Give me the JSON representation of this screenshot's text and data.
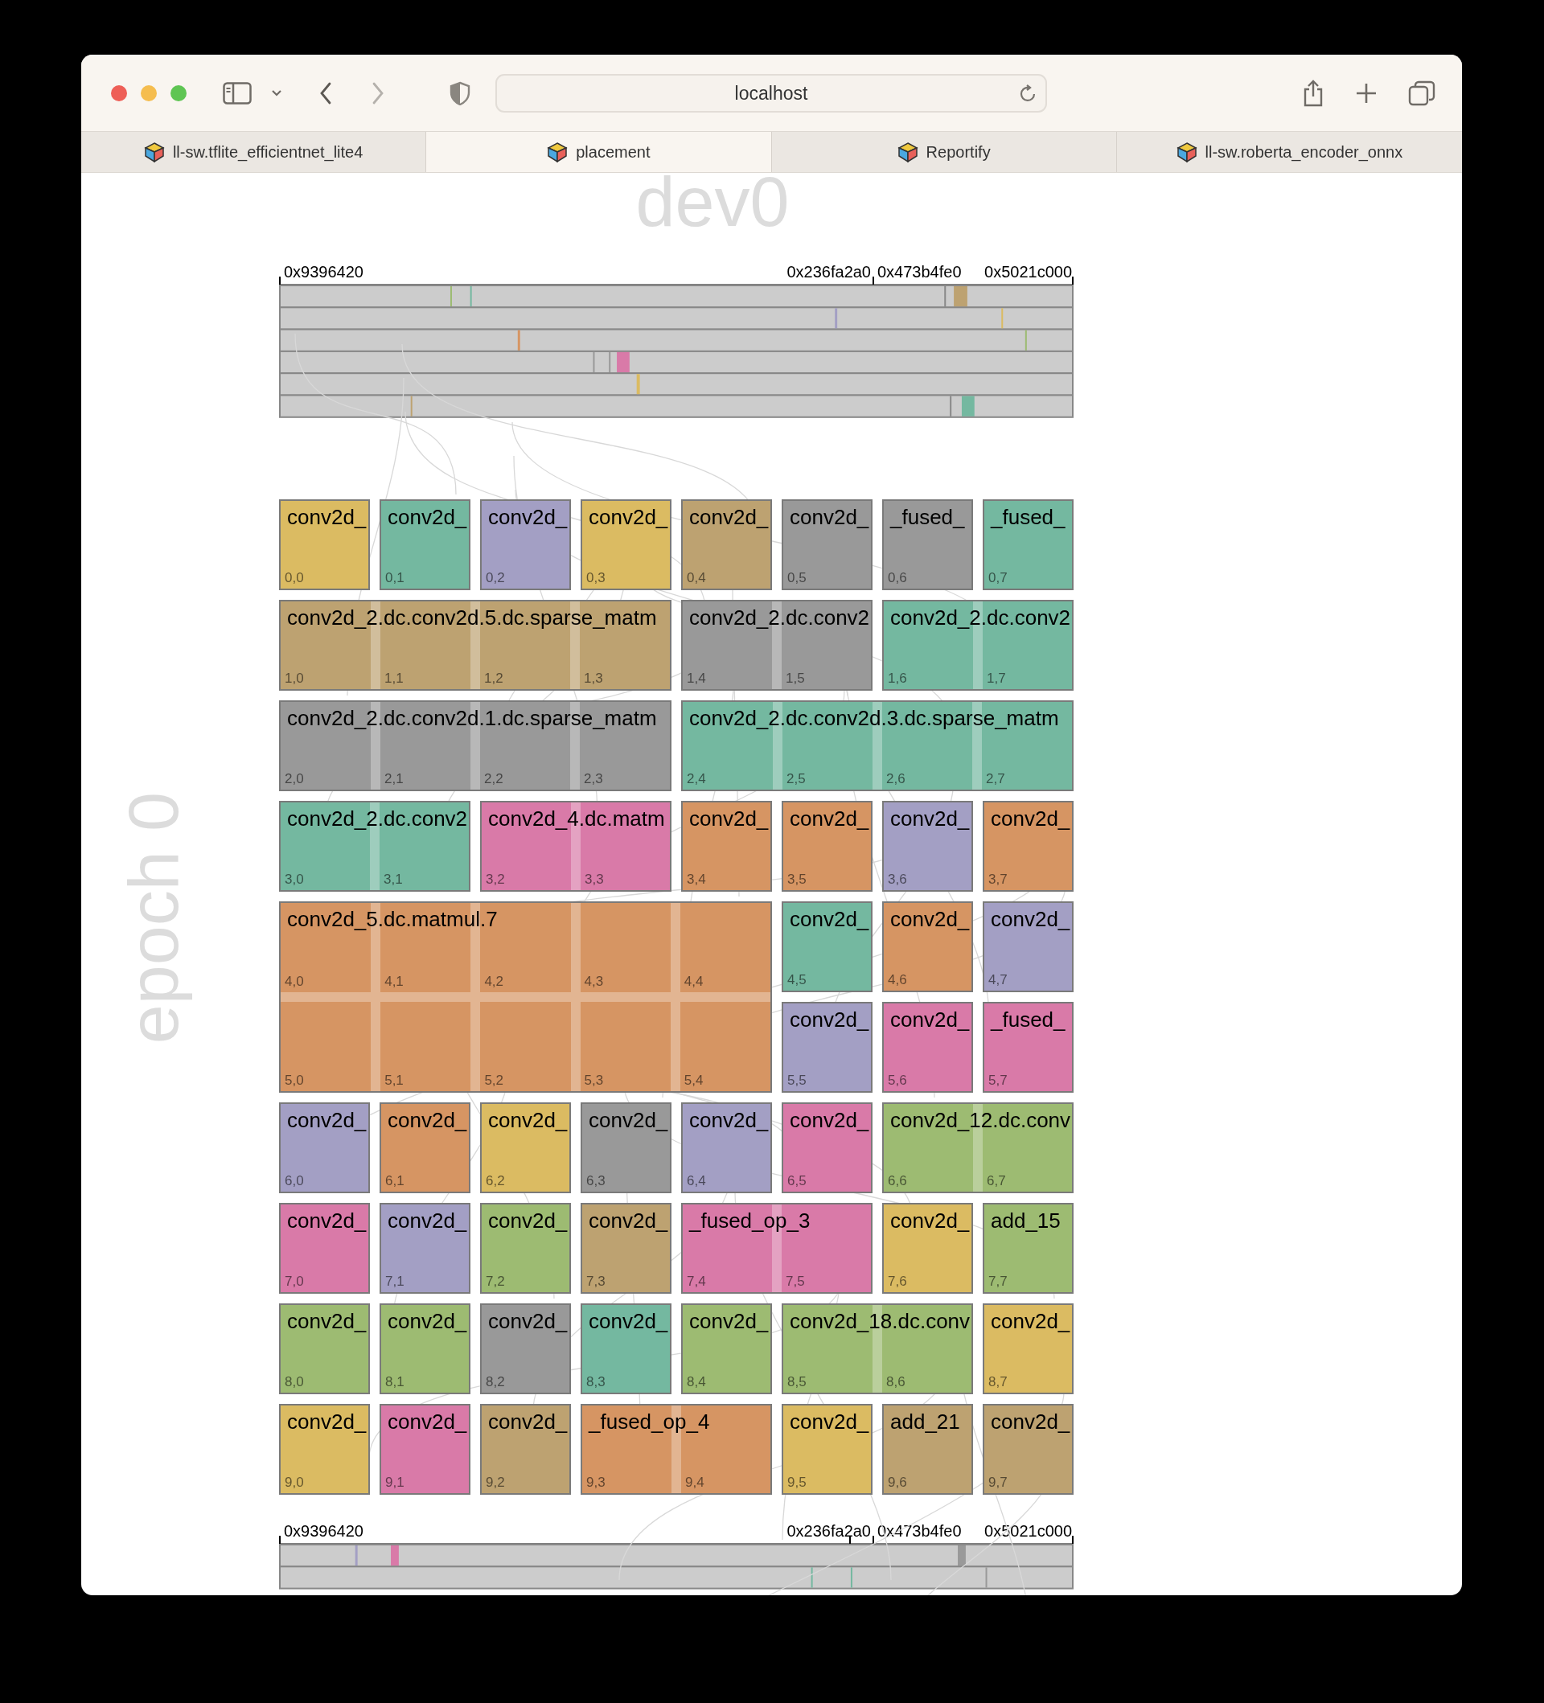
{
  "browser": {
    "address": "localhost",
    "tabs": [
      {
        "title": "ll-sw.tflite_efficientnet_lite4",
        "selected": false
      },
      {
        "title": "placement",
        "selected": true
      },
      {
        "title": "Reportify",
        "selected": false
      },
      {
        "title": "ll-sw.roberta_encoder_onnx",
        "selected": false
      }
    ]
  },
  "device": "dev0",
  "epoch": "epoch 0",
  "top_axis": {
    "labels": [
      "0x9396420",
      "0x236fa2a0",
      "0x473b4fe0",
      "0x5021c000"
    ]
  },
  "bottom_axis": {
    "labels": [
      "0x9396420",
      "0x236fa2a0",
      "0x473b4fe0",
      "0x5021c000"
    ]
  },
  "blocks": [
    {
      "label": "conv2d_",
      "color": "#dbbb62",
      "cells": [
        [
          "0,0"
        ]
      ]
    },
    {
      "label": "conv2d_",
      "color": "#74b8a0",
      "cells": [
        [
          "0,1"
        ]
      ]
    },
    {
      "label": "conv2d_",
      "color": "#a39fc4",
      "cells": [
        [
          "0,2"
        ]
      ]
    },
    {
      "label": "conv2d_",
      "color": "#dbbb62",
      "cells": [
        [
          "0,3"
        ]
      ]
    },
    {
      "label": "conv2d_",
      "color": "#bda271",
      "cells": [
        [
          "0,4"
        ]
      ]
    },
    {
      "label": "conv2d_",
      "color": "#999999",
      "cells": [
        [
          "0,5"
        ]
      ]
    },
    {
      "label": "_fused_",
      "color": "#999999",
      "cells": [
        [
          "0,6"
        ]
      ]
    },
    {
      "label": "_fused_",
      "color": "#74b8a0",
      "cells": [
        [
          "0,7"
        ]
      ]
    },
    {
      "label": "conv2d_2.dc.conv2d.5.dc.sparse_matm",
      "color": "#bda271",
      "cells": [
        [
          "1,0",
          "1,1",
          "1,2",
          "1,3"
        ]
      ]
    },
    {
      "label": "conv2d_2.dc.conv2",
      "color": "#999999",
      "cells": [
        [
          "1,4",
          "1,5"
        ]
      ]
    },
    {
      "label": "conv2d_2.dc.conv2",
      "color": "#74b8a0",
      "cells": [
        [
          "1,6",
          "1,7"
        ]
      ]
    },
    {
      "label": "conv2d_2.dc.conv2d.1.dc.sparse_matm",
      "color": "#999999",
      "cells": [
        [
          "2,0",
          "2,1",
          "2,2",
          "2,3"
        ]
      ]
    },
    {
      "label": "conv2d_2.dc.conv2d.3.dc.sparse_matm",
      "color": "#74b8a0",
      "cells": [
        [
          "2,4",
          "2,5",
          "2,6",
          "2,7"
        ]
      ]
    },
    {
      "label": "conv2d_2.dc.conv2",
      "color": "#74b8a0",
      "cells": [
        [
          "3,0",
          "3,1"
        ]
      ]
    },
    {
      "label": "conv2d_4.dc.matm",
      "color": "#d97aa8",
      "cells": [
        [
          "3,2",
          "3,3"
        ]
      ]
    },
    {
      "label": "conv2d_",
      "color": "#d69563",
      "cells": [
        [
          "3,4"
        ]
      ]
    },
    {
      "label": "conv2d_",
      "color": "#d69563",
      "cells": [
        [
          "3,5"
        ]
      ]
    },
    {
      "label": "conv2d_",
      "color": "#a39fc4",
      "cells": [
        [
          "3,6"
        ]
      ]
    },
    {
      "label": "conv2d_",
      "color": "#d69563",
      "cells": [
        [
          "3,7"
        ]
      ]
    },
    {
      "label": "conv2d_5.dc.matmul.7",
      "color": "#d69563",
      "cells": [
        [
          "4,0",
          "4,1",
          "4,2",
          "4,3",
          "4,4"
        ],
        [
          "5,0",
          "5,1",
          "5,2",
          "5,3",
          "5,4"
        ]
      ]
    },
    {
      "label": "conv2d_",
      "color": "#74b8a0",
      "cells": [
        [
          "4,5"
        ]
      ]
    },
    {
      "label": "conv2d_",
      "color": "#d69563",
      "cells": [
        [
          "4,6"
        ]
      ]
    },
    {
      "label": "conv2d_",
      "color": "#a39fc4",
      "cells": [
        [
          "4,7"
        ]
      ]
    },
    {
      "label": "conv2d_",
      "color": "#a39fc4",
      "cells": [
        [
          "5,5"
        ]
      ]
    },
    {
      "label": "conv2d_",
      "color": "#d97aa8",
      "cells": [
        [
          "5,6"
        ]
      ]
    },
    {
      "label": "_fused_",
      "color": "#d97aa8",
      "cells": [
        [
          "5,7"
        ]
      ]
    },
    {
      "label": "conv2d_",
      "color": "#a39fc4",
      "cells": [
        [
          "6,0"
        ]
      ]
    },
    {
      "label": "conv2d_",
      "color": "#d69563",
      "cells": [
        [
          "6,1"
        ]
      ]
    },
    {
      "label": "conv2d_",
      "color": "#dbbb62",
      "cells": [
        [
          "6,2"
        ]
      ]
    },
    {
      "label": "conv2d_",
      "color": "#999999",
      "cells": [
        [
          "6,3"
        ]
      ]
    },
    {
      "label": "conv2d_",
      "color": "#a39fc4",
      "cells": [
        [
          "6,4"
        ]
      ]
    },
    {
      "label": "conv2d_",
      "color": "#d97aa8",
      "cells": [
        [
          "6,5"
        ]
      ]
    },
    {
      "label": "conv2d_12.dc.conv",
      "color": "#9dbb72",
      "cells": [
        [
          "6,6",
          "6,7"
        ]
      ]
    },
    {
      "label": "conv2d_",
      "color": "#d97aa8",
      "cells": [
        [
          "7,0"
        ]
      ]
    },
    {
      "label": "conv2d_",
      "color": "#a39fc4",
      "cells": [
        [
          "7,1"
        ]
      ]
    },
    {
      "label": "conv2d_",
      "color": "#9dbb72",
      "cells": [
        [
          "7,2"
        ]
      ]
    },
    {
      "label": "conv2d_",
      "color": "#bda271",
      "cells": [
        [
          "7,3"
        ]
      ]
    },
    {
      "label": "_fused_op_3",
      "color": "#d97aa8",
      "cells": [
        [
          "7,4",
          "7,5"
        ]
      ]
    },
    {
      "label": "conv2d_",
      "color": "#dbbb62",
      "cells": [
        [
          "7,6"
        ]
      ]
    },
    {
      "label": "add_15",
      "color": "#9dbb72",
      "cells": [
        [
          "7,7"
        ]
      ]
    },
    {
      "label": "conv2d_",
      "color": "#9dbb72",
      "cells": [
        [
          "8,0"
        ]
      ]
    },
    {
      "label": "conv2d_",
      "color": "#9dbb72",
      "cells": [
        [
          "8,1"
        ]
      ]
    },
    {
      "label": "conv2d_",
      "color": "#999999",
      "cells": [
        [
          "8,2"
        ]
      ]
    },
    {
      "label": "conv2d_",
      "color": "#74b8a0",
      "cells": [
        [
          "8,3"
        ]
      ]
    },
    {
      "label": "conv2d_",
      "color": "#9dbb72",
      "cells": [
        [
          "8,4"
        ]
      ]
    },
    {
      "label": "conv2d_18.dc.conv",
      "color": "#9dbb72",
      "cells": [
        [
          "8,5",
          "8,6"
        ]
      ]
    },
    {
      "label": "conv2d_",
      "color": "#dbbb62",
      "cells": [
        [
          "8,7"
        ]
      ]
    },
    {
      "label": "conv2d_",
      "color": "#dbbb62",
      "cells": [
        [
          "9,0"
        ]
      ]
    },
    {
      "label": "conv2d_",
      "color": "#d97aa8",
      "cells": [
        [
          "9,1"
        ]
      ]
    },
    {
      "label": "conv2d_",
      "color": "#bda271",
      "cells": [
        [
          "9,2"
        ]
      ]
    },
    {
      "label": "_fused_op_4",
      "color": "#d69563",
      "cells": [
        [
          "9,3",
          "9,4"
        ]
      ]
    },
    {
      "label": "conv2d_",
      "color": "#dbbb62",
      "cells": [
        [
          "9,5"
        ]
      ]
    },
    {
      "label": "add_21",
      "color": "#bda271",
      "cells": [
        [
          "9,6"
        ]
      ]
    },
    {
      "label": "conv2d_",
      "color": "#bda271",
      "cells": [
        [
          "9,7"
        ]
      ]
    }
  ]
}
